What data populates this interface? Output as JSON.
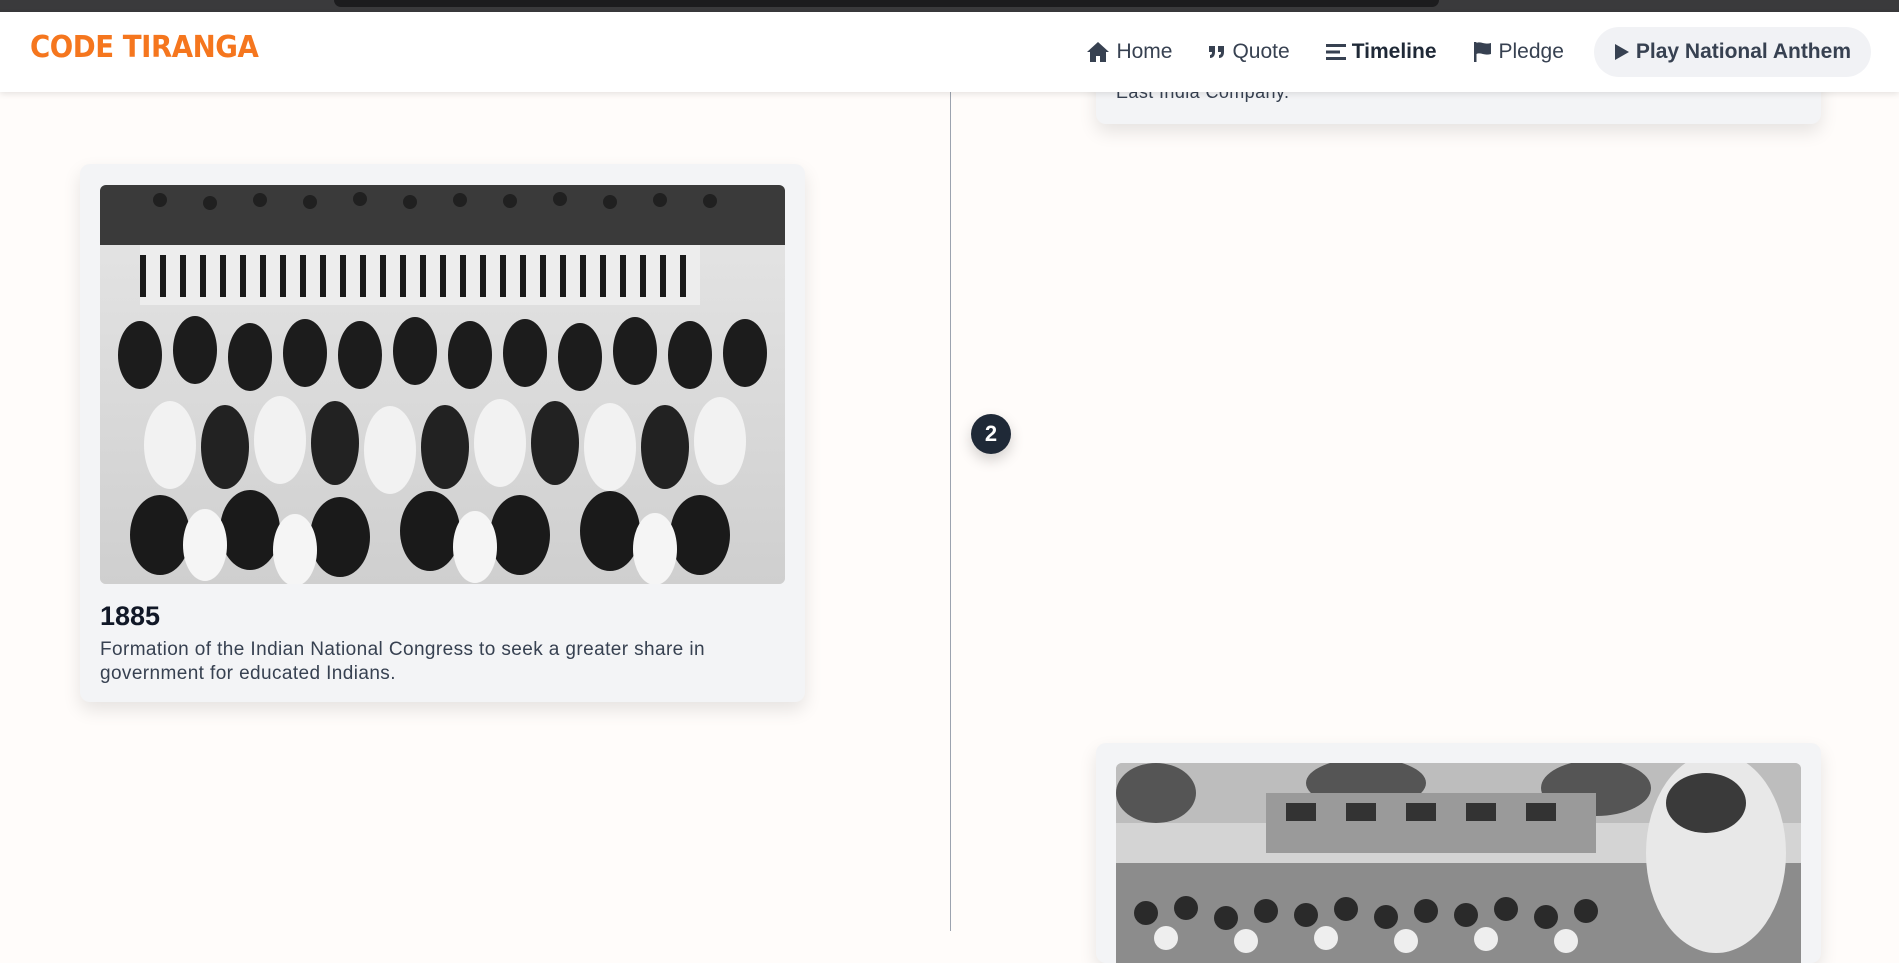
{
  "brand": {
    "name": "CODE TIRANGA",
    "color": "#f5761e"
  },
  "nav": {
    "home": {
      "label": "Home",
      "icon": "home-icon"
    },
    "quote": {
      "label": "Quote",
      "icon": "quote-icon"
    },
    "timeline": {
      "label": "Timeline",
      "icon": "list-icon"
    },
    "pledge": {
      "label": "Pledge",
      "icon": "flag-icon"
    },
    "anthem": {
      "label": "Play National Anthem",
      "icon": "play-icon"
    }
  },
  "timeline": {
    "marker_number": "2",
    "entries": [
      {
        "year": "",
        "description": "East India Company."
      },
      {
        "year": "1885",
        "description": "Formation of the Indian National Congress to seek a greater share in government for educated Indians."
      },
      {
        "year": "",
        "description": ""
      }
    ]
  }
}
